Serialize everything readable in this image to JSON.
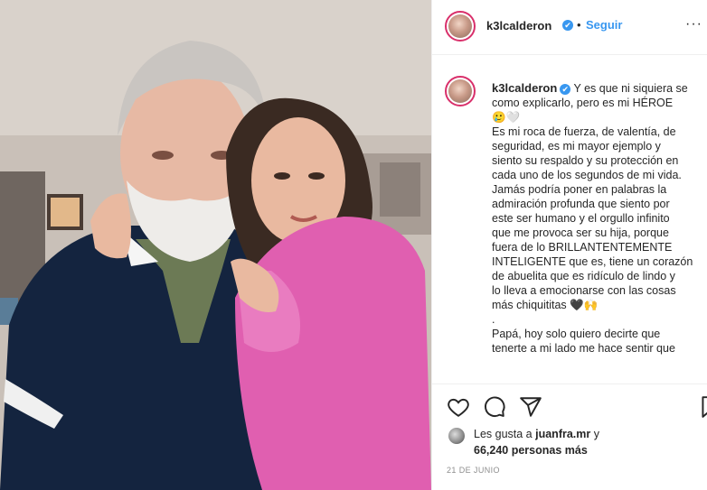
{
  "post": {
    "username": "k3lcalderon",
    "verified_symbol": "✔",
    "separator": "•",
    "follow_label": "Seguir",
    "more_symbol": "···",
    "caption_lines": [
      "Y es que ni siquiera se",
      "como explicarlo, pero es mi HÉROE",
      "🥲🤍",
      "Es mi roca de fuerza, de valentía, de",
      "seguridad, es mi mayor ejemplo y",
      "siento su respaldo y su protección en",
      "cada uno de los segundos de mi vida.",
      "Jamás podría poner en palabras la",
      "admiración profunda que siento por",
      "este ser humano y el orgullo infinito",
      "que me provoca ser su hija, porque",
      "fuera de lo BRILLANTENTEMENTE",
      "INTELIGENTE que es, tiene un corazón",
      "de abuelita que es ridículo de lindo y",
      "lo lleva a emocionarse con las cosas",
      "más chiquititas 🖤🙌",
      ".",
      "Papá, hoy solo quiero decirte que",
      "tenerte a mi lado me hace sentir que"
    ],
    "likes_prefix": "Les gusta a",
    "liker": "juanfra.mr",
    "likes_joiner": "y",
    "likes_count": "66,240",
    "likes_suffix": "personas más",
    "date": "21 DE JUNIO"
  }
}
